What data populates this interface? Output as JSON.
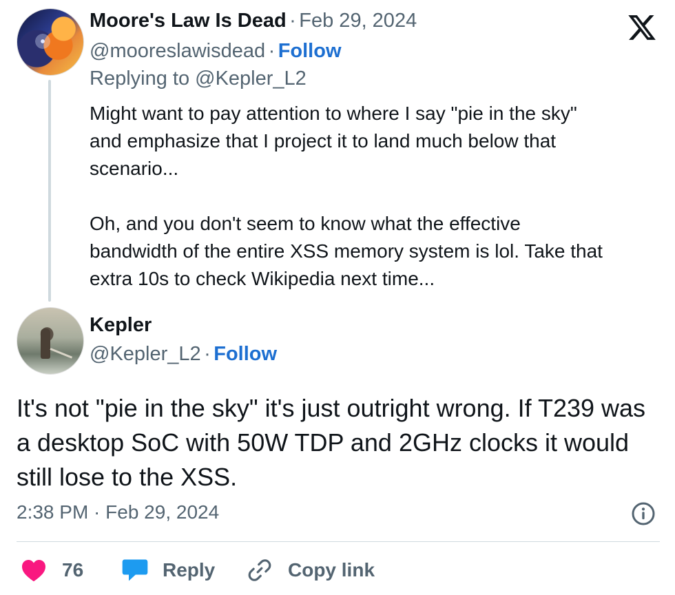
{
  "reply_tweet": {
    "author_name": "Moore's Law Is Dead",
    "separator": "·",
    "date": "Feb 29, 2024",
    "handle": "@mooreslawisdead",
    "follow_label": "Follow",
    "replying_to": "Replying to @Kepler_L2",
    "paragraph_1": "Might want to pay attention to where I say \"pie in the sky\"\nand emphasize that I project it to land much below that\nscenario...",
    "paragraph_2": "Oh, and you don't seem to know what the effective\nbandwidth of the entire XSS memory system is lol. Take that\nextra 10s to check Wikipedia next time..."
  },
  "main_tweet": {
    "author_name": "Kepler",
    "handle": "@Kepler_L2",
    "separator": "·",
    "follow_label": "Follow",
    "text": "It's not \"pie in the sky\" it's just outright wrong. If T239 was a desktop SoC with 50W TDP and 2GHz clocks it would still lose to the XSS.",
    "timestamp": "2:38 PM · Feb 29, 2024"
  },
  "actions": {
    "likes_count": "76",
    "reply_label": "Reply",
    "copy_link_label": "Copy link"
  },
  "icons": {
    "brand": "x-logo-icon",
    "info": "info-icon",
    "like": "heart-icon",
    "reply": "speech-bubble-icon",
    "copy": "link-icon"
  },
  "colors": {
    "text": "#0f1419",
    "muted": "#536471",
    "follow": "#1d6fd1",
    "like": "#f91880",
    "reply": "#1d9bf0",
    "divider": "#cfd9de"
  }
}
